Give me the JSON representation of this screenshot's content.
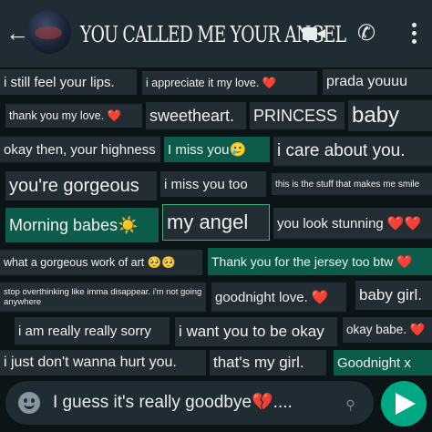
{
  "header": {
    "back_icon": "arrow-left-icon",
    "contact_title": "YOU CALLED ME YOUR ANGEL",
    "video_call_icon": "video-camera-icon",
    "voice_call_icon": "phone-icon",
    "menu_icon": "three-dots-icon"
  },
  "messages": [
    {
      "text": "i still feel your lips."
    },
    {
      "text": "i appreciate it my love. ❤️"
    },
    {
      "text": "prada youuu"
    },
    {
      "text": "thank you my love. ❤️"
    },
    {
      "text": "sweetheart."
    },
    {
      "text": "PRINCESS"
    },
    {
      "text": "baby"
    },
    {
      "text": "okay then, your highness"
    },
    {
      "text": "I miss you🥲"
    },
    {
      "text": "i care about you."
    },
    {
      "text": "you're gorgeous"
    },
    {
      "text": "i miss you too"
    },
    {
      "text": "this is the stuff that makes me smile"
    },
    {
      "text": "Morning babes☀️"
    },
    {
      "text": "my angel"
    },
    {
      "text": "you look stunning ❤️❤️"
    },
    {
      "text": "what a gorgeous work of art 🥺🥺"
    },
    {
      "text": "Thank you for the jersey too btw ❤️"
    },
    {
      "text": "stop overthinking like imma disappear. i'm not going anywhere"
    },
    {
      "text": "goodnight love. ❤️"
    },
    {
      "text": "baby girl."
    },
    {
      "text": "i am really really sorry"
    },
    {
      "text": "i want you to be okay"
    },
    {
      "text": "okay babe. ❤️"
    },
    {
      "text": "i just don't wanna hurt you."
    },
    {
      "text": "that's my girl."
    },
    {
      "text": "Goodnight x"
    }
  ],
  "input": {
    "emoji_icon": "smiley-icon",
    "text": "I guess it's really goodbye💔....",
    "attach_icon": "paperclip-icon",
    "send_icon": "send-arrow-icon"
  },
  "colors": {
    "header_bg": "#1f2c33",
    "chat_bg": "#0b1417",
    "incoming_bubble": "#232d34",
    "outgoing_bubble": "#0b5c4a",
    "accent": "#00a884"
  }
}
